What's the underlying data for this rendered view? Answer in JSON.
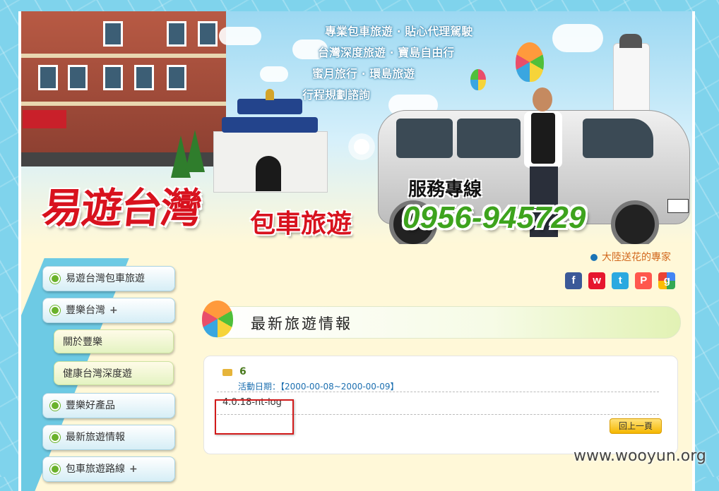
{
  "banner": {
    "slogans": [
      "專業包車旅遊 · 貼心代理駕駛",
      "台灣深度旅遊 · 寶島自由行",
      "蜜月旅行 · 環島旅遊",
      "行程規劃諮詢"
    ],
    "brand_name": "易遊台灣",
    "brand_subtitle": "包車旅遊",
    "hotline_label": "服務專線",
    "hotline_number": "0956-945729"
  },
  "header": {
    "promo_link": "大陸送花的專家",
    "social_icons": [
      "facebook-icon",
      "weibo-icon",
      "twitter-icon",
      "plurk-icon",
      "google-icon"
    ]
  },
  "sidebar": {
    "items": [
      {
        "label": "易遊台灣包車旅遊",
        "expandable": false
      },
      {
        "label": "豐樂台灣",
        "expandable": true
      },
      {
        "label": "關於豐樂",
        "sub": true
      },
      {
        "label": "健康台灣深度遊",
        "sub": true
      },
      {
        "label": "豐樂好產品",
        "expandable": false
      },
      {
        "label": "最新旅遊情報",
        "expandable": false
      },
      {
        "label": "包車旅遊路線",
        "expandable": true
      }
    ],
    "plus_glyph": "+"
  },
  "main": {
    "section_title": "最新旅遊情報",
    "entry": {
      "title": "6",
      "date": "活動日期：【2000-00-08~2000-00-09】",
      "content": "4.0.18-nt-log",
      "back_label": "回上一頁"
    }
  },
  "watermark": "www.wooyun.org",
  "colors": {
    "brand_red": "#d8121e",
    "hotline_green": "#3da31d",
    "background_blue": "#7fd3ec",
    "highlight_box": "#d21b1b"
  }
}
